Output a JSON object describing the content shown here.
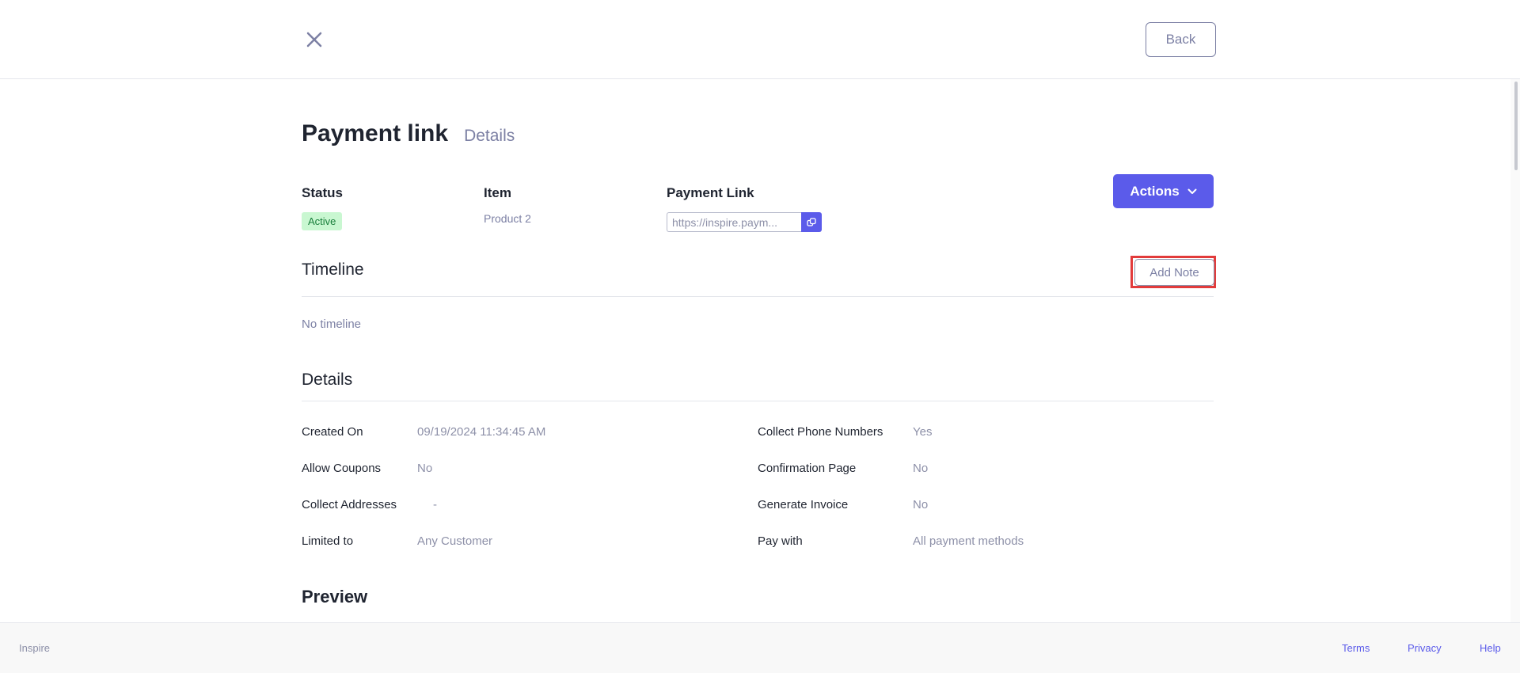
{
  "header": {
    "close_icon": "close-icon",
    "back_label": "Back"
  },
  "page": {
    "title": "Payment link",
    "subtitle": "Details"
  },
  "summary": {
    "status_label": "Status",
    "status_value": "Active",
    "item_label": "Item",
    "item_value": "Product 2",
    "link_label": "Payment Link",
    "link_value": "https://inspire.paym...",
    "copy_icon": "copy-icon"
  },
  "actions": {
    "label": "Actions",
    "icon": "chevron-down-icon"
  },
  "timeline": {
    "title": "Timeline",
    "add_note_label": "Add Note",
    "empty_text": "No timeline"
  },
  "details": {
    "title": "Details",
    "left": [
      {
        "label": "Created On",
        "value": "09/19/2024 11:34:45 AM"
      },
      {
        "label": "Allow Coupons",
        "value": "No"
      },
      {
        "label": "Collect Addresses",
        "value": "-"
      },
      {
        "label": "Limited to",
        "value": "Any Customer"
      }
    ],
    "right": [
      {
        "label": "Collect Phone Numbers",
        "value": "Yes"
      },
      {
        "label": "Confirmation Page",
        "value": "No"
      },
      {
        "label": "Generate Invoice",
        "value": "No"
      },
      {
        "label": "Pay with",
        "value": "All payment methods"
      }
    ]
  },
  "preview": {
    "title": "Preview"
  },
  "footer": {
    "brand": "Inspire",
    "links": [
      "Terms",
      "Privacy",
      "Help"
    ]
  },
  "colors": {
    "accent": "#5b5bea",
    "muted_text": "#7c80a4",
    "status_bg": "#c9f7d1",
    "status_text": "#1a7f3c",
    "highlight": "#e23b3b"
  }
}
